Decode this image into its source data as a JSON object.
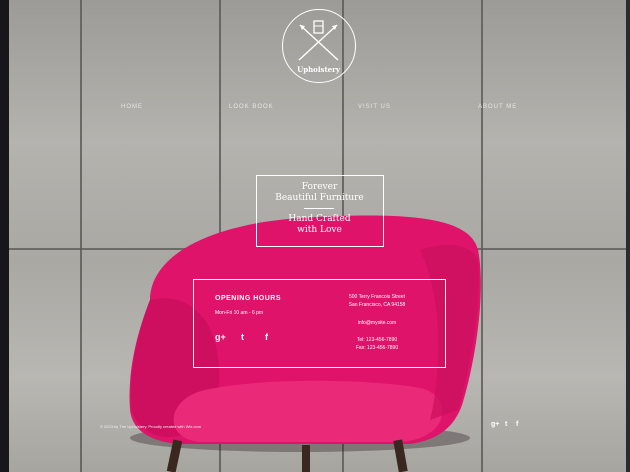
{
  "colors": {
    "accent_pink": "#e3156e",
    "wall": "#b2b1ac",
    "seam": "#5e5d59",
    "text": "#ffffff"
  },
  "logo": {
    "name": "Upholstery",
    "icon": "crossed-arrows-logo-icon"
  },
  "nav": {
    "items": [
      {
        "label": "HOME"
      },
      {
        "label": "LOOK BOOK"
      },
      {
        "label": "VISIT US"
      },
      {
        "label": "ABOUT ME"
      }
    ]
  },
  "tagline": {
    "line1": "Forever",
    "line2": "Beautiful Furniture",
    "line3": "Hand Crafted",
    "line4": "with Love"
  },
  "hours": {
    "title": "OPENING HOURS",
    "text": "Mon-Fri 10 am - 6 pm",
    "social": [
      {
        "glyph": "g+",
        "icon": "google-plus-icon"
      },
      {
        "glyph": "t",
        "icon": "twitter-icon"
      },
      {
        "glyph": "f",
        "icon": "facebook-icon"
      }
    ]
  },
  "contact": {
    "address1": "500 Terry Francois Street",
    "address2": "San Francisco, CA 94158",
    "email": "info@mysite.com",
    "tel": "Tel: 123-456-7890",
    "fax": "Fax: 123-456-7890"
  },
  "footer": {
    "copyright": "© 2023 by The Upholstery. Proudly created with Wix.com",
    "social": [
      {
        "glyph": "g+",
        "icon": "google-plus-icon"
      },
      {
        "glyph": "t",
        "icon": "twitter-icon"
      },
      {
        "glyph": "f",
        "icon": "facebook-icon"
      }
    ]
  }
}
